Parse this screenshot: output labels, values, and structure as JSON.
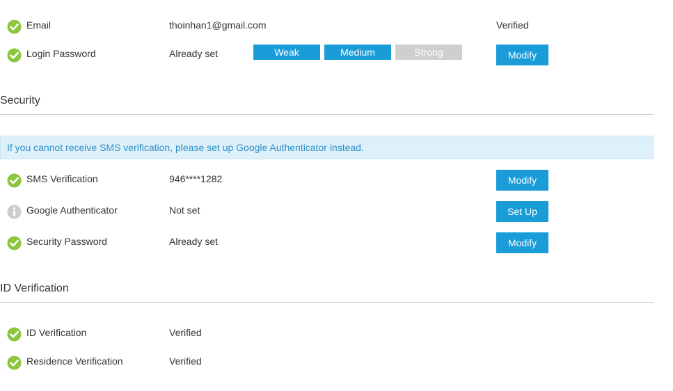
{
  "colors": {
    "accent": "#1a9cd8",
    "verified_green": "#8cc63f",
    "info_grey": "#cccccc",
    "strength_inactive": "#cfcfcf",
    "notice_bg": "#def0fa",
    "notice_text": "#2e8fc7"
  },
  "account": {
    "email": {
      "icon": "check-circle-icon",
      "label": "Email",
      "value": "thoinhan1@gmail.com",
      "status": "Verified"
    },
    "login_password": {
      "icon": "check-circle-icon",
      "label": "Login Password",
      "value": "Already set",
      "strength": [
        {
          "label": "Weak",
          "active": true
        },
        {
          "label": "Medium",
          "active": true
        },
        {
          "label": "Strong",
          "active": false
        }
      ],
      "button": "Modify"
    }
  },
  "security": {
    "title": "Security",
    "notice": "If you cannot receive SMS verification, please set up Google Authenticator instead.",
    "items": [
      {
        "icon": "check-circle-icon",
        "label": "SMS Verification",
        "value": "946****1282",
        "button": "Modify"
      },
      {
        "icon": "info-circle-icon",
        "label": "Google Authenticator",
        "value": "Not set",
        "button": "Set Up"
      },
      {
        "icon": "check-circle-icon",
        "label": "Security Password",
        "value": "Already set",
        "button": "Modify"
      }
    ]
  },
  "id_verification": {
    "title": "ID Verification",
    "items": [
      {
        "icon": "check-circle-icon",
        "label": "ID Verification",
        "value": "Verified"
      },
      {
        "icon": "check-circle-icon",
        "label": "Residence Verification",
        "value": "Verified"
      }
    ]
  }
}
